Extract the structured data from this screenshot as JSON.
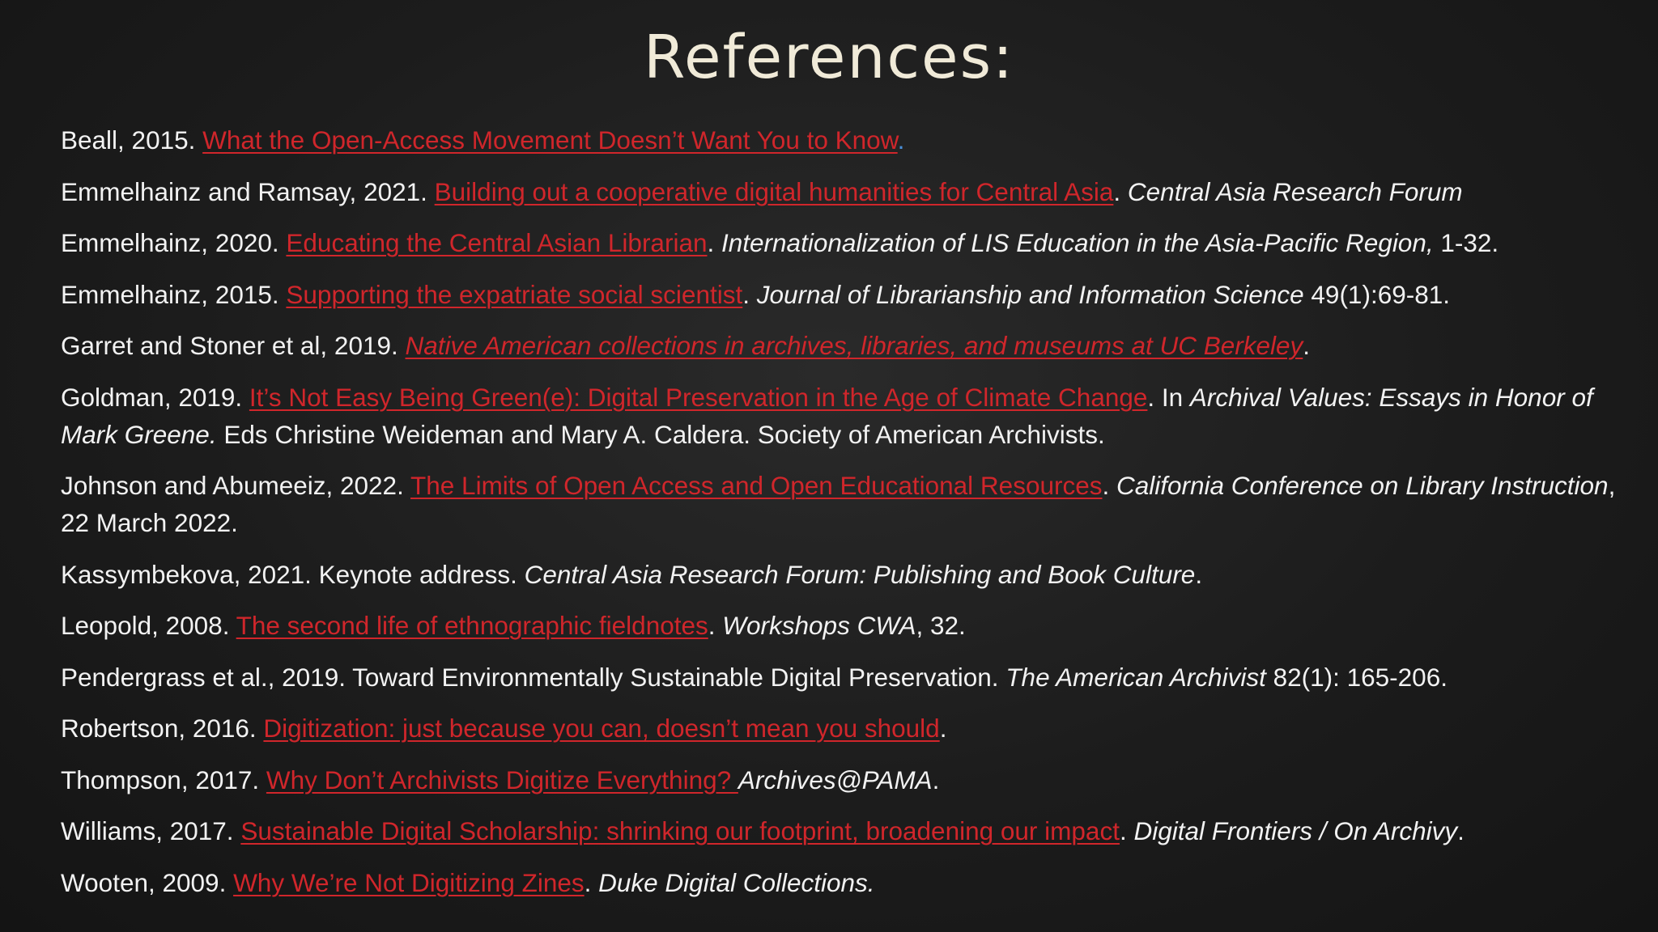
{
  "slide": {
    "title": "References:"
  },
  "references": [
    {
      "pre": "Beall, 2015. ",
      "link": "What the Open-Access Movement Doesn’t Want You to Know",
      "post": "."
    },
    {
      "pre": "Emmelhainz and Ramsay, 2021. ",
      "link": "Building out a cooperative digital humanities for Central Asia",
      "post": ". ",
      "italic": "Central Asia Research Forum"
    },
    {
      "pre": "Emmelhainz, 2020. ",
      "link": "Educating the Central Asian Librarian",
      "post": ". ",
      "italic": "Internationalization of LIS Education in the Asia-Pacific Region,",
      "tail": " 1-32."
    },
    {
      "pre": "Emmelhainz, 2015. ",
      "link": "Supporting the expatriate social scientist",
      "post": ". ",
      "italic": "Journal of Librarianship and Information Science",
      "tail": " 49(1):69-81."
    },
    {
      "pre": "Garret and Stoner et al, 2019. ",
      "link": "Native American collections in archives, libraries, and museums at UC Berkeley",
      "post": "."
    },
    {
      "pre": "Goldman, 2019. ",
      "link": "It’s Not Easy Being Green(e): Digital Preservation in the Age of Climate Change",
      "post": ". In ",
      "italic": "Archival Values: Essays in Honor of Mark Greene.",
      "tail": " Eds Christine Weideman and Mary A. Caldera. Society of American Archivists."
    },
    {
      "pre": "Johnson and Abumeeiz, 2022. ",
      "link": "The Limits of Open Access and Open Educational Resources",
      "post": ". ",
      "italic": "California Conference on Library Instruction",
      "tail": ", 22 March 2022."
    },
    {
      "pre": "Kassymbekova, 2021. Keynote address. ",
      "italic": "Central Asia Research Forum: Publishing and Book Culture",
      "tail": "."
    },
    {
      "pre": "Leopold, 2008. ",
      "link": "The second life of ethnographic fieldnotes",
      "post": ". ",
      "italic": "Workshops CWA",
      "tail": ", 32."
    },
    {
      "pre": "Pendergrass et al., 2019. Toward Environmentally Sustainable Digital Preservation. ",
      "italic": "The American Archivist",
      "tail": " 82(1): 165-206."
    },
    {
      "pre": "Robertson, 2016. ",
      "link": "Digitization: just because you can, doesn’t mean you should",
      "post": "."
    },
    {
      "pre": "Thompson, 2017. ",
      "link": "Why Don’t Archivists Digitize Everything? ",
      "italic": "Archives@PAMA",
      "tail": "."
    },
    {
      "pre": "Williams, 2017. ",
      "link": "Sustainable Digital Scholarship: shrinking our footprint, broadening our impact",
      "post": ". ",
      "italic": "Digital Frontiers  / On Archivy",
      "tail": "."
    },
    {
      "pre": "Wooten, 2009. ",
      "link": "Why We’re Not Digitizing Zines",
      "post": ". ",
      "italic": "Duke Digital Collections."
    }
  ],
  "colors": {
    "link": "#d0262b",
    "text": "#f2f2f2",
    "title": "#f0ead8",
    "background": "#1c1c1c"
  }
}
